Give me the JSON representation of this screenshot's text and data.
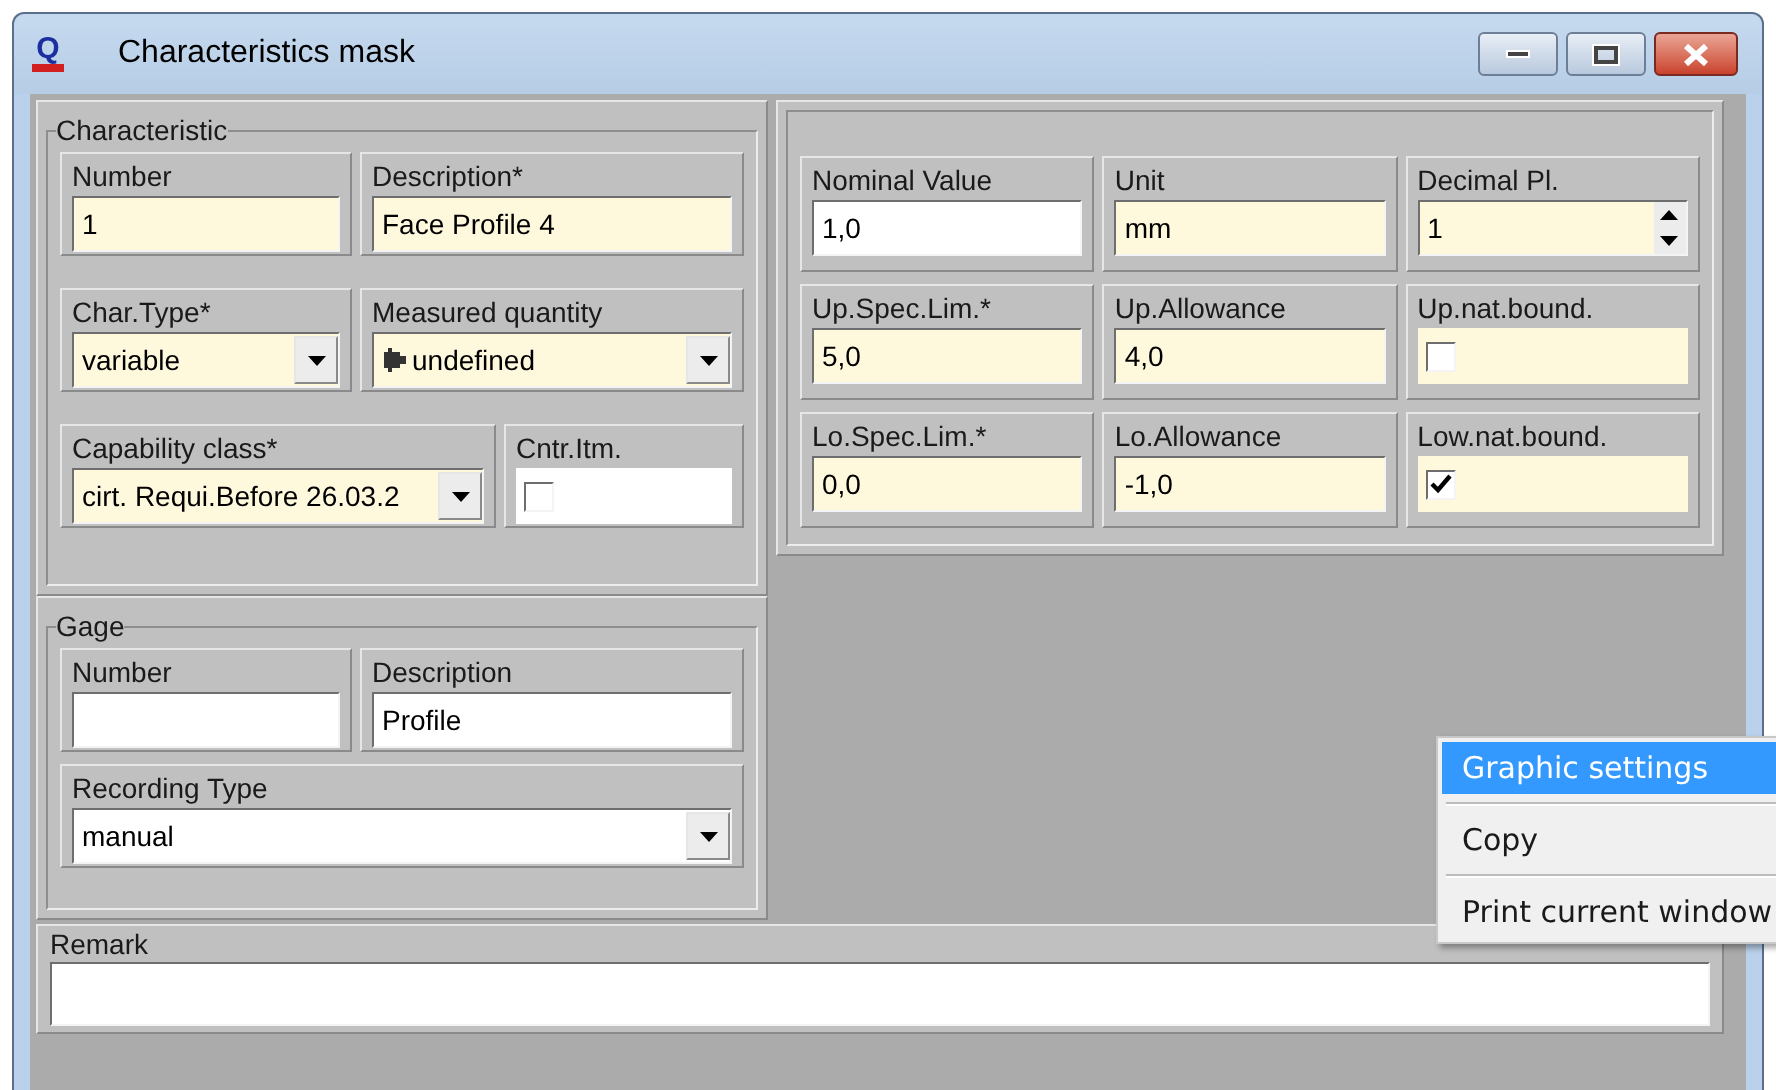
{
  "window": {
    "title": "Characteristics mask",
    "logo": "Q"
  },
  "characteristic": {
    "title": "Characteristic",
    "rows": [
      [
        {
          "label": "Number",
          "kind": "text",
          "value": "1",
          "highlighted": true
        },
        {
          "label": "Description*",
          "kind": "text",
          "value": "Face Profile 4",
          "highlighted": true
        }
      ],
      [
        {
          "label": "Char.Type*",
          "kind": "dropdown",
          "value": "variable",
          "highlighted": true
        },
        {
          "label": "Measured quantity",
          "kind": "dropdown",
          "value": "undefined",
          "highlighted": true,
          "icon": true
        }
      ],
      [
        {
          "label": "Capability class*",
          "kind": "dropdown",
          "value": "cirt. Requi.Before 26.03.2",
          "highlighted": true
        },
        {
          "label": "Cntr.Itm.",
          "kind": "checkbox",
          "checked": false,
          "highlighted": false
        }
      ]
    ]
  },
  "limits": {
    "rows": [
      [
        {
          "label": "Nominal Value",
          "kind": "text",
          "value": "1,0",
          "highlighted": false
        },
        {
          "label": "Unit",
          "kind": "text",
          "value": "mm",
          "highlighted": true
        },
        {
          "label": "Decimal Pl.",
          "kind": "spinner",
          "value": "1",
          "highlighted": true
        }
      ],
      [
        {
          "label": "Up.Spec.Lim.*",
          "kind": "text",
          "value": "5,0",
          "highlighted": true
        },
        {
          "label": "Up.Allowance",
          "kind": "text",
          "value": "4,0",
          "highlighted": true
        },
        {
          "label": "Up.nat.bound.",
          "kind": "checkbox",
          "checked": false,
          "highlighted": true
        }
      ],
      [
        {
          "label": "Lo.Spec.Lim.*",
          "kind": "text",
          "value": "0,0",
          "highlighted": true
        },
        {
          "label": "Lo.Allowance",
          "kind": "text",
          "value": "-1,0",
          "highlighted": true
        },
        {
          "label": "Low.nat.bound.",
          "kind": "checkbox",
          "checked": true,
          "highlighted": true
        }
      ]
    ]
  },
  "gage": {
    "title": "Gage",
    "rows": [
      [
        {
          "label": "Number",
          "kind": "text",
          "highlighted": false
        },
        {
          "label": "Description",
          "kind": "text",
          "value": "Profile",
          "highlighted": false
        }
      ],
      [
        {
          "label": "Recording Type",
          "kind": "dropdown",
          "value": "manual",
          "highlighted": false
        }
      ]
    ]
  },
  "remark": {
    "label": "Remark"
  },
  "context_menu": {
    "items": [
      {
        "label": "Graphic settings",
        "selected": true
      },
      {
        "label": "Copy",
        "selected": false
      },
      {
        "label": "Print current window",
        "selected": false
      }
    ]
  }
}
